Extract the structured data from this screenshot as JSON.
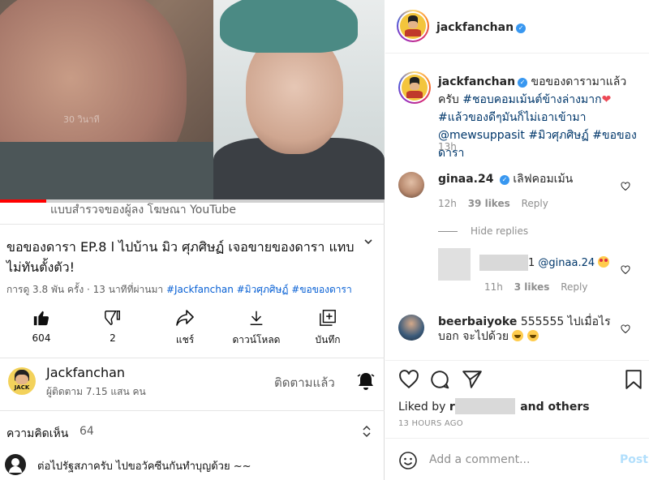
{
  "youtube": {
    "watermark": "30 วินาที",
    "survey_text": "แบบสำรวจของผู้ลง โฆษณา YouTube",
    "title": "ขอของดารา EP.8 l ไปบ้าน มิว ศุภศิษฏ์ เจอขายของดารา แทบไม่ทันตั้งตัว!",
    "meta_views": "การดู 3.8 พัน ครั้ง · 13 นาทีที่ผ่านมา",
    "hashtags": [
      "#Jackfanchan",
      "#มิวศุภศิษฏ์",
      "#ขอของดารา"
    ],
    "actions": {
      "like": "604",
      "dislike": "2",
      "share": "แชร์",
      "download": "ดาวน์โหลด",
      "save": "บันทึก"
    },
    "channel": {
      "avatar_text": "JACK",
      "name": "Jackfanchan",
      "subs": "ผู้ติดตาม 7.15 แสน คน",
      "follow": "ติดตามแล้ว"
    },
    "comments": {
      "label": "ความคิดเห็น",
      "count": "64",
      "first": "ต่อไปรัฐสภาครับ ไปขอวัคซีนกันทำบุญด้วย ~~"
    }
  },
  "instagram": {
    "header_username": "jackfanchan",
    "caption": {
      "username": "jackfanchan",
      "text_1": "ขอของดารามาแล้วครับ",
      "text_2": "#ชอบคอมเม้นต์ข้างล่างมาก",
      "text_3": "#แล้วของดีๆมันก็ไม่เอาเข้ามา",
      "mention": "@mewsuppasit",
      "tag_1": "#มิวศุภศิษฏ์",
      "tag_2": "#ขอของดารา",
      "time": "13h"
    },
    "comments": [
      {
        "username": "ginaa.24",
        "text": "เลิฟคอมเม้น",
        "time": "12h",
        "likes": "39 likes",
        "reply": "Reply"
      },
      {
        "username": "beerbaiyoke",
        "text": "555555 ไปเมื่อไรบอก จะไปด้วย"
      }
    ],
    "hide_replies": "Hide replies",
    "reply": {
      "prefix": "1",
      "mention": "@ginaa.24",
      "time": "11h",
      "likes": "3 likes",
      "reply": "Reply"
    },
    "liked_by": "Liked by",
    "liked_prefix": "r",
    "and_others": "and others",
    "timestamp": "13 HOURS AGO",
    "add_comment_placeholder": "Add a comment...",
    "post_label": "Post"
  }
}
